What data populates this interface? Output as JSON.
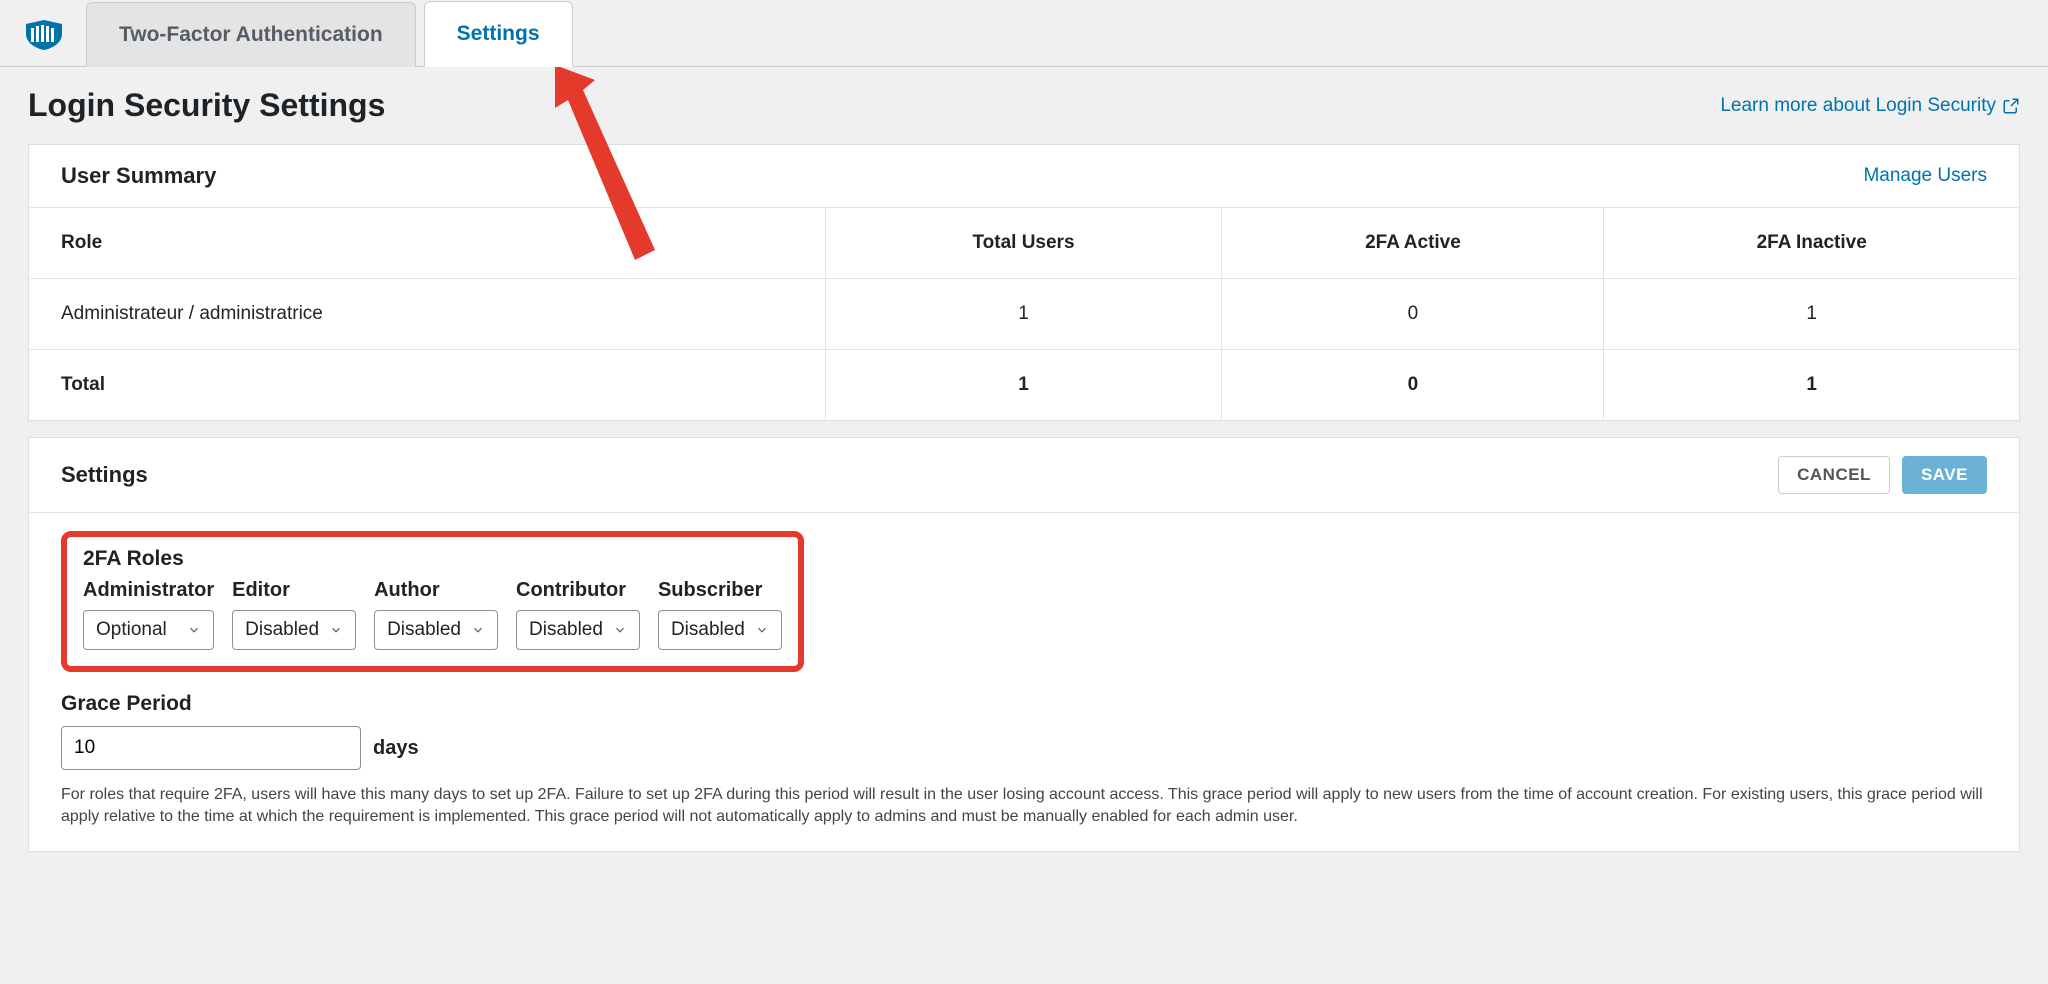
{
  "tabs": {
    "tfa": "Two-Factor Authentication",
    "settings": "Settings"
  },
  "page_title": "Login Security Settings",
  "learn_more": "Learn more about Login Security",
  "user_summary": {
    "title": "User Summary",
    "manage": "Manage Users",
    "headers": {
      "role": "Role",
      "total": "Total Users",
      "active": "2FA Active",
      "inactive": "2FA Inactive"
    },
    "rows": [
      {
        "role": "Administrateur / administratrice",
        "total": "1",
        "active": "0",
        "inactive": "1"
      }
    ],
    "total_row": {
      "label": "Total",
      "total": "1",
      "active": "0",
      "inactive": "1"
    }
  },
  "settings_panel": {
    "title": "Settings",
    "cancel": "CANCEL",
    "save": "SAVE",
    "roles_title": "2FA Roles",
    "roles": {
      "admin_label": "Administrator",
      "admin_value": "Optional",
      "editor_label": "Editor",
      "editor_value": "Disabled",
      "author_label": "Author",
      "author_value": "Disabled",
      "contributor_label": "Contributor",
      "contributor_value": "Disabled",
      "subscriber_label": "Subscriber",
      "subscriber_value": "Disabled"
    },
    "grace": {
      "label": "Grace Period",
      "value": "10",
      "suffix": "days",
      "desc": "For roles that require 2FA, users will have this many days to set up 2FA. Failure to set up 2FA during this period will result in the user losing account access. This grace period will apply to new users from the time of account creation. For existing users, this grace period will apply relative to the time at which the requirement is implemented. This grace period will not automatically apply to admins and must be manually enabled for each admin user."
    }
  }
}
